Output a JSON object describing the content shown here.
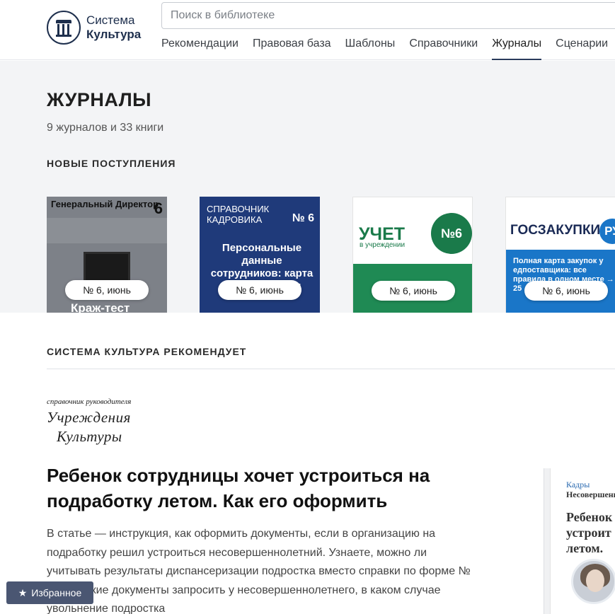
{
  "header": {
    "logo_line1": "Система",
    "logo_line2": "Культура",
    "search_placeholder": "Поиск в библиотеке",
    "nav": [
      {
        "label": "Рекомендации"
      },
      {
        "label": "Правовая база"
      },
      {
        "label": "Шаблоны"
      },
      {
        "label": "Справочники"
      },
      {
        "label": "Журналы",
        "active": true
      },
      {
        "label": "Сценарии"
      }
    ]
  },
  "main": {
    "title": "ЖУРНАЛЫ",
    "subtitle": "9 журналов и 33 книги",
    "new_section": "НОВЫЕ ПОСТУПЛЕНИЯ",
    "covers": [
      {
        "title": "Генеральный Директор",
        "number": "6",
        "bottom": "Краж-тест",
        "issue": "№ 6, июнь"
      },
      {
        "title": "СПРАВОЧНИК КАДРОВИКА",
        "number": "№ 6",
        "headline": "Персональные данные сотрудников: карта рисков, па...ты",
        "issue": "№ 6, июнь"
      },
      {
        "title": "УЧЕТ",
        "subtitle": "в учреждении",
        "number": "№6",
        "issue": "№ 6, июнь"
      },
      {
        "title": "ГОСЗАКУПКИ",
        "badge": "РУ",
        "text": "Полная карта закупок у едпоставщика: все правила в одном месте → 25",
        "issue": "№ 6, июнь"
      }
    ]
  },
  "recommend": {
    "section_title": "СИСТЕМА КУЛЬТУРА РЕКОМЕНДУЕТ",
    "brand_small": "справочник руководителя",
    "brand_line1": "Учреждения",
    "brand_line2": "Культуры",
    "article_title": "Ребенок сотрудницы хочет устроиться на подработку летом. Как его оформить",
    "article_text": "В статье — инструкция, как оформить документы, если в организацию на подработку решил устроиться несовершеннолетний. Узнаете, можно ли учитывать результаты диспансеризации подростка вместо справки по форме № 086/у, какие документы запросить у несовершеннолетнего, в каком случае увольнение подростка",
    "preview_category": "Кадры",
    "preview_sub": "Несовершенн",
    "preview_title_1": "Ребенок",
    "preview_title_2": "устроит",
    "preview_title_3": "летом."
  },
  "favorites": {
    "label": "Избранное"
  }
}
